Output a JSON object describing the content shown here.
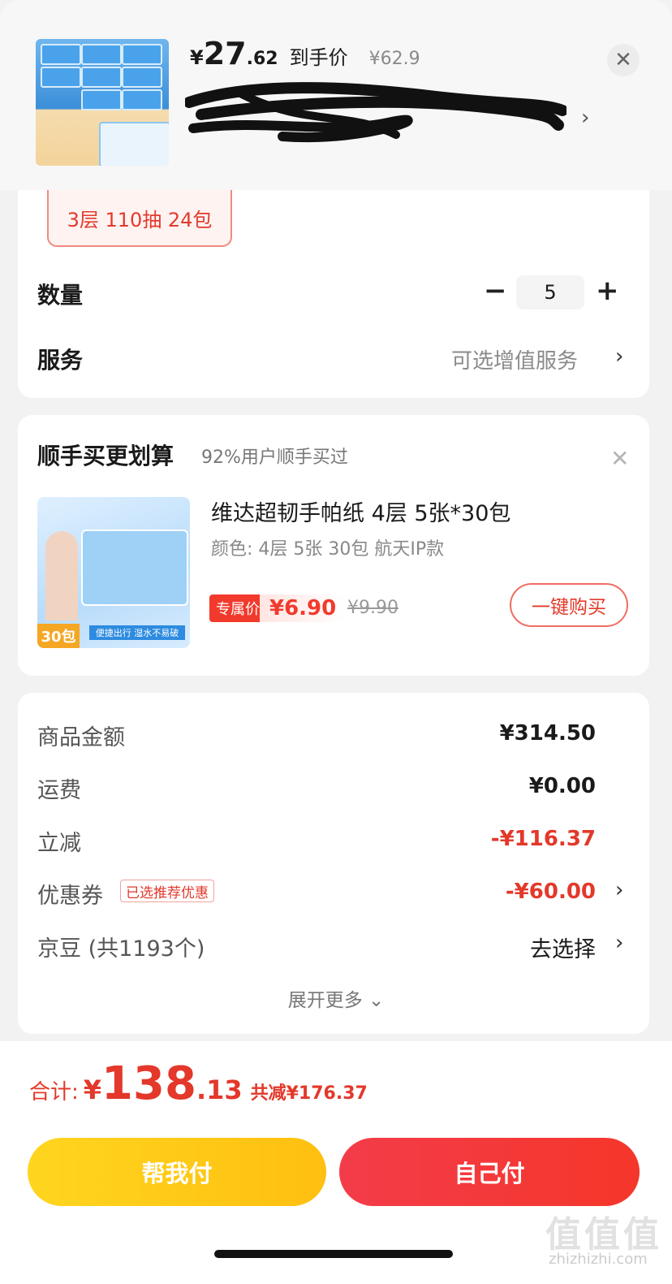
{
  "header": {
    "price_yen": "¥",
    "price_int": "27",
    "price_dec": ".62",
    "price_label": "到手价",
    "original_price": "¥62.9",
    "address_obscured": true
  },
  "sku": {
    "selected_spec": "3层 110抽 24包"
  },
  "quantity": {
    "label": "数量",
    "value": "5",
    "minus": "−",
    "plus": "+"
  },
  "service": {
    "label": "服务",
    "value": "可选增值服务",
    "chevron": "›"
  },
  "upsell": {
    "title": "顺手买更划算",
    "subtitle": "92%用户顺手买过",
    "product_name": "维达超韧手帕纸 4层 5张*30包",
    "product_spec": "颜色: 4层 5张 30包 航天IP款",
    "exclusive_tag": "专属价",
    "exclusive_price": "¥6.90",
    "original_price": "¥9.90",
    "buy_button": "一键购买",
    "image_badge": "30包",
    "image_caption": "便捷出行 湿水不易破"
  },
  "fees": {
    "goods_label": "商品金额",
    "goods_value": "¥314.50",
    "shipping_label": "运费",
    "shipping_value": "¥0.00",
    "discount_label": "立减",
    "discount_value": "-¥116.37",
    "coupon_label": "优惠券",
    "coupon_tag": "已选推荐优惠",
    "coupon_value": "-¥60.00",
    "beans_label": "京豆 (共1193个)",
    "beans_value": "去选择",
    "expand_label": "展开更多 ⌄"
  },
  "footer": {
    "total_label": "合计:",
    "total_yen": "¥",
    "total_int": "138",
    "total_dec": ".13",
    "total_saved": "共减¥176.37",
    "pay_help_button": "帮我付",
    "pay_self_button": "自己付"
  },
  "watermark": {
    "text": "值值值",
    "site": "zhizhizhi.com"
  },
  "colors": {
    "accent_red": "#e3382a",
    "yellow_button": "#ffc814",
    "red_button": "#f3382c"
  }
}
